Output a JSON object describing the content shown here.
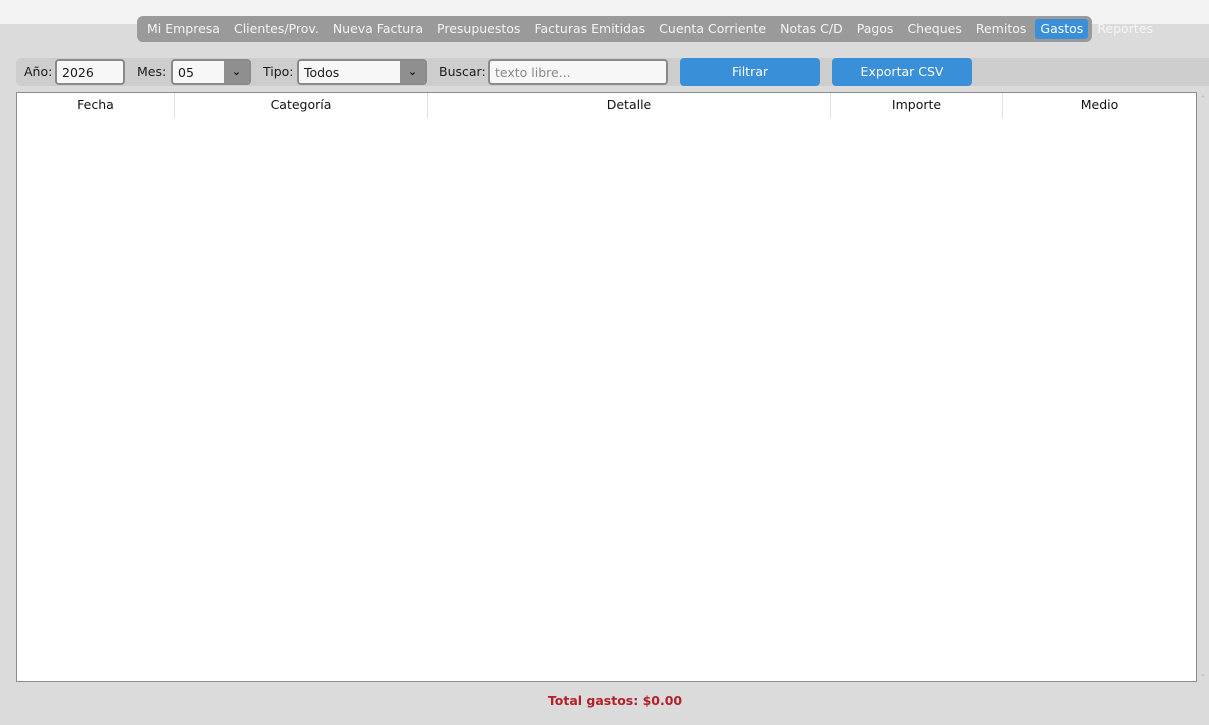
{
  "nav": {
    "tabs": [
      {
        "label": "Mi Empresa"
      },
      {
        "label": "Clientes/Prov."
      },
      {
        "label": "Nueva Factura"
      },
      {
        "label": "Presupuestos"
      },
      {
        "label": "Facturas Emitidas"
      },
      {
        "label": "Cuenta Corriente"
      },
      {
        "label": "Notas C/D"
      },
      {
        "label": "Pagos"
      },
      {
        "label": "Cheques"
      },
      {
        "label": "Remitos"
      },
      {
        "label": "Gastos"
      },
      {
        "label": "Reportes"
      }
    ],
    "active": "Gastos"
  },
  "filters": {
    "year_label": "Año:",
    "year_value": "2026",
    "month_label": "Mes:",
    "month_value": "05",
    "type_label": "Tipo:",
    "type_value": "Todos",
    "search_label": "Buscar:",
    "search_placeholder": "texto libre...",
    "search_value": "",
    "filter_button": "Filtrar",
    "export_button": "Exportar CSV",
    "dropdown_icon": "chevron-down-icon"
  },
  "table": {
    "columns": [
      "Fecha",
      "Categoría",
      "Detalle",
      "Importe",
      "Medio"
    ],
    "rows": []
  },
  "footer": {
    "total_text": "Total gastos: $0.00"
  },
  "colors": {
    "accent": "#3a8fd9",
    "total_text": "#b3202a",
    "tabbar": "#9a9a9a",
    "background": "#dbdbdb"
  }
}
